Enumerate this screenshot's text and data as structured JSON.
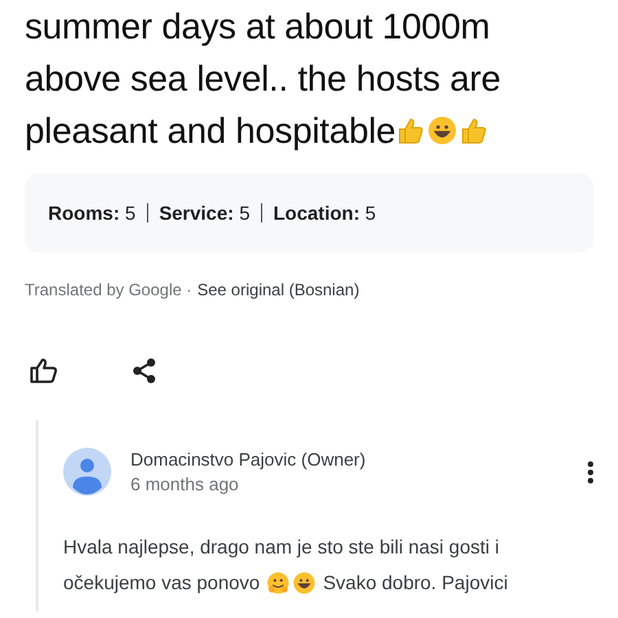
{
  "review": {
    "lines": [
      "summer days at about 1000m",
      "above sea level.. the hosts are",
      "pleasant and hospitable"
    ],
    "ratings": [
      {
        "label": "Rooms:",
        "value": "5"
      },
      {
        "label": "Service:",
        "value": "5"
      },
      {
        "label": "Location:",
        "value": "5"
      }
    ],
    "translation": {
      "note": "Translated by Google ·",
      "link": "See original (Bosnian)"
    }
  },
  "reply": {
    "author": "Domacinstvo Pajovic (Owner)",
    "time": "6 months ago",
    "lines": [
      "Hvala najlepse, drago nam je sto ste bili nasi gosti i",
      "očekujemo vas ponovo"
    ],
    "text_end": "Svako dobro. Pajovici"
  }
}
